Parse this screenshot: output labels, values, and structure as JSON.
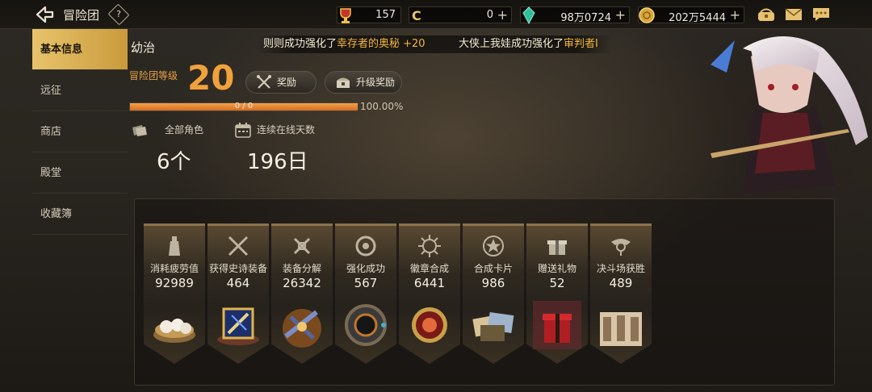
{
  "header": {
    "title": "冒险团",
    "help_label": "?",
    "resources": [
      {
        "name": "trophy",
        "value": "157",
        "icon": "trophy-icon"
      },
      {
        "name": "cera",
        "value": "0",
        "icon": "cera-coin-icon",
        "has_plus": true
      },
      {
        "name": "gem",
        "value": "98万0724",
        "icon": "green-gem-icon",
        "has_plus": true
      },
      {
        "name": "gold",
        "value": "202万5444",
        "icon": "gold-coin-icon",
        "has_plus": true
      }
    ],
    "plus": "+"
  },
  "sidebar": {
    "items": [
      {
        "label": "基本信息",
        "active": true
      },
      {
        "label": "远征",
        "active": false
      },
      {
        "label": "商店",
        "active": false
      },
      {
        "label": "殿堂",
        "active": false
      },
      {
        "label": "收藏簿",
        "active": false
      }
    ]
  },
  "info": {
    "name": "幼治",
    "level_label": "冒险团等级",
    "level": "20",
    "reward_button": "奖励",
    "upgrade_reward_button": "升级奖励",
    "progress_text": "0 / 0",
    "progress_percent": "100.00%",
    "progress_fraction": 1.0,
    "all_roles_label": "全部角色",
    "all_roles_value": "6个",
    "online_days_label": "连续在线天数",
    "online_days_value": "196日"
  },
  "ticker": {
    "msg1_prefix": "则则成功强化了",
    "msg1_item": "幸存者的奥秘 +20",
    "msg2_prefix": "大侠上我娃成功强化了",
    "msg2_item": "审判者I"
  },
  "achievements": [
    {
      "label": "消耗疲劳值",
      "value": "92989",
      "icon": "bottle-icon",
      "art": "buns-art"
    },
    {
      "label": "获得史诗装备",
      "value": "464",
      "icon": "crossed-swords-icon",
      "art": "epic-weapon-art"
    },
    {
      "label": "装备分解",
      "value": "26342",
      "icon": "disassemble-icon",
      "art": "disassemble-art"
    },
    {
      "label": "强化成功",
      "value": "567",
      "icon": "reinforce-icon",
      "art": "ring-art"
    },
    {
      "label": "徽章合成",
      "value": "6441",
      "icon": "emblem-icon",
      "art": "emblem-art"
    },
    {
      "label": "合成卡片",
      "value": "986",
      "icon": "star-icon",
      "art": "cards-art"
    },
    {
      "label": "赠送礼物",
      "value": "52",
      "icon": "gift-icon",
      "art": "gift-box-art"
    },
    {
      "label": "决斗场获胜",
      "value": "489",
      "icon": "arena-icon",
      "art": "arena-art"
    }
  ],
  "colors": {
    "accent_gold": "#e8c36b",
    "level_orange": "#f0a13b",
    "highlight": "#f2b53c"
  }
}
